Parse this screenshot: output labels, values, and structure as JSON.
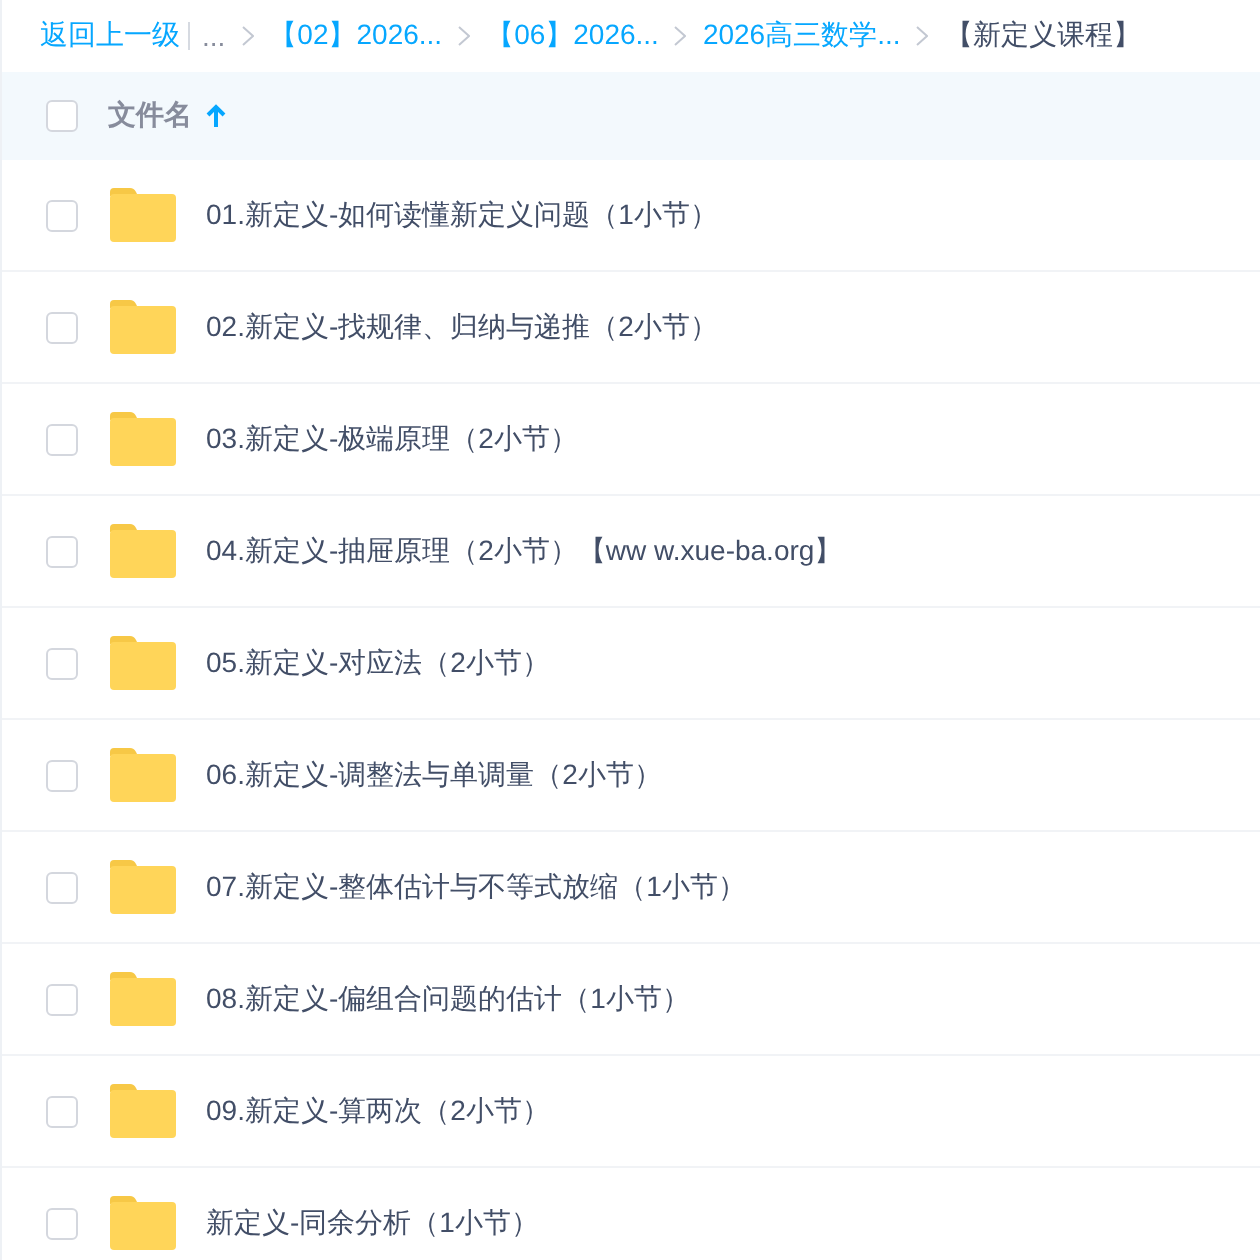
{
  "breadcrumb": {
    "back_link": "返回上一级",
    "ellipsis": "...",
    "items": [
      {
        "label": "【02】2026...",
        "current": false
      },
      {
        "label": "【06】2026...",
        "current": false
      },
      {
        "label": "2026高三数学...",
        "current": false
      },
      {
        "label": "【新定义课程】",
        "current": true
      }
    ]
  },
  "header": {
    "checked": false,
    "column": "文件名",
    "sort_ascending": true
  },
  "rows": [
    {
      "name": "01.新定义-如何读懂新定义问题（1小节）",
      "checked": false
    },
    {
      "name": "02.新定义-找规律、归纳与递推（2小节）",
      "checked": false
    },
    {
      "name": "03.新定义-极端原理（2小节）",
      "checked": false
    },
    {
      "name": "04.新定义-抽屉原理（2小节）【ww w.xue-ba.org】",
      "checked": false
    },
    {
      "name": "05.新定义-对应法（2小节）",
      "checked": false
    },
    {
      "name": "06.新定义-调整法与单调量（2小节）",
      "checked": false
    },
    {
      "name": "07.新定义-整体估计与不等式放缩（1小节）",
      "checked": false
    },
    {
      "name": "08.新定义-偏组合问题的估计（1小节）",
      "checked": false
    },
    {
      "name": "09.新定义-算两次（2小节）",
      "checked": false
    },
    {
      "name": "新定义-同余分析（1小节）",
      "checked": false
    }
  ]
}
